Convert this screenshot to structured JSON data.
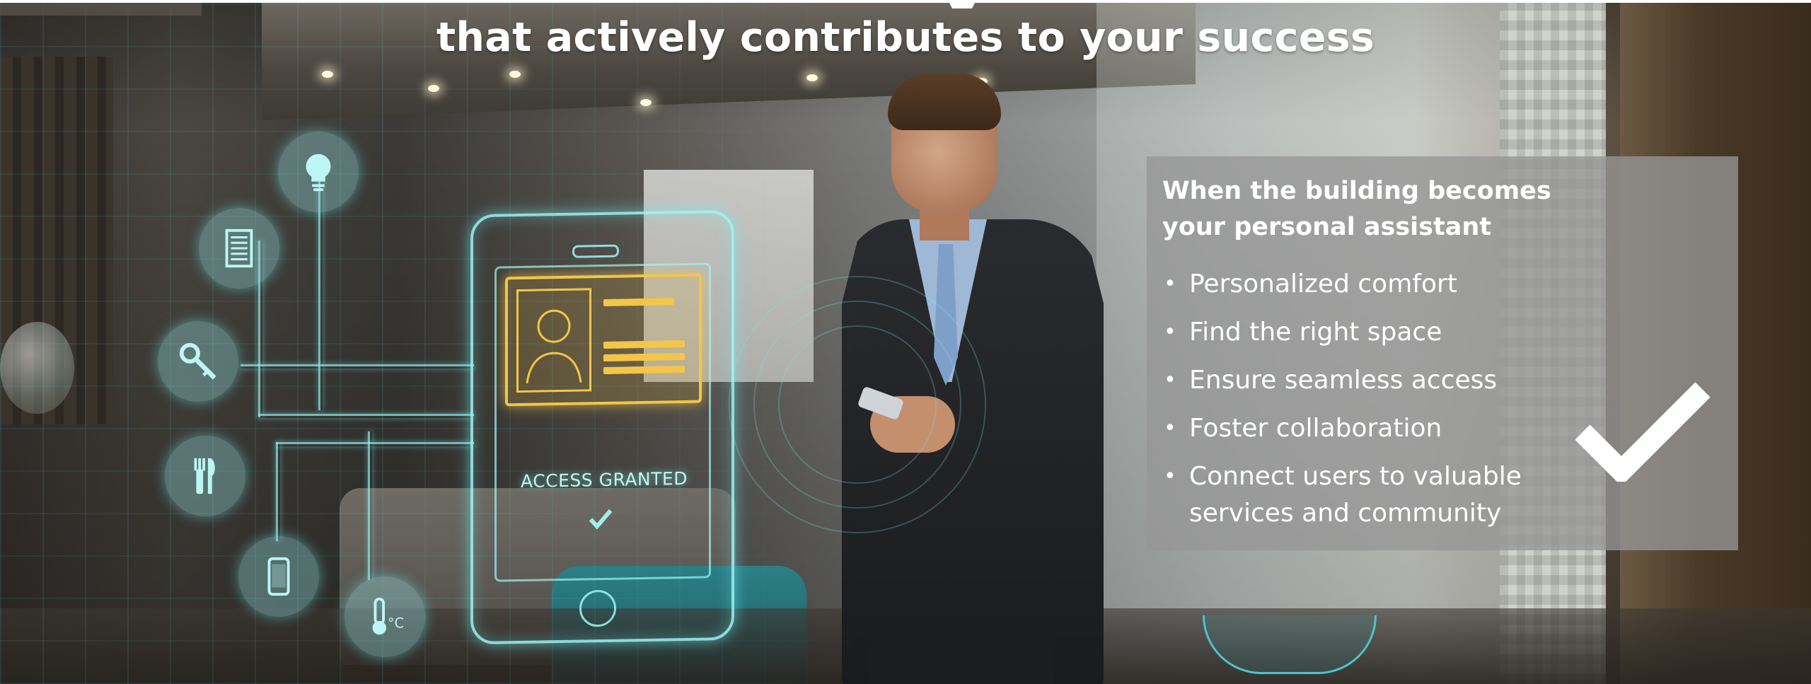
{
  "slide": {
    "headline": "that actively contributes to your success",
    "corner_text": "",
    "panel": {
      "title": "When the building becomes your personal assistant",
      "bullets": [
        "Personalized comfort",
        "Find the right space",
        "Ensure seamless access",
        "Foster collaboration",
        "Connect users to valuable services and community"
      ],
      "check_icon": "checkmark-icon"
    },
    "hologram": {
      "phone_status_text": "ACCESS GRANTED",
      "icons": [
        "lightbulb-icon",
        "document-icon",
        "key-icon",
        "fork-knife-icon",
        "phone-icon",
        "thermometer-icon"
      ],
      "accent_color": "#7fe8ea",
      "card_color": "#f3c64a"
    }
  }
}
